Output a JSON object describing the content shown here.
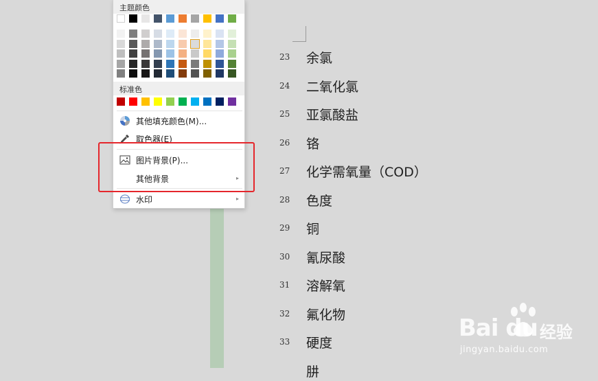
{
  "menu": {
    "theme_header": "主题颜色",
    "standard_header": "标准色",
    "theme_colors": [
      "#ffffff",
      "#000000",
      "#e7e6e6",
      "#44546a",
      "#5b9bd5",
      "#ed7d31",
      "#a5a5a5",
      "#ffc000",
      "#4472c4",
      "#70ad47"
    ],
    "shade_columns": [
      [
        "#f2f2f2",
        "#d9d9d9",
        "#bfbfbf",
        "#a6a6a6",
        "#808080"
      ],
      [
        "#7f7f7f",
        "#595959",
        "#404040",
        "#262626",
        "#0d0d0d"
      ],
      [
        "#d0cece",
        "#aeabab",
        "#757171",
        "#3a3838",
        "#171616"
      ],
      [
        "#d6dce5",
        "#adb9ca",
        "#8497b0",
        "#333f50",
        "#222a35"
      ],
      [
        "#deebf7",
        "#bdd7ee",
        "#9dc3e6",
        "#2e75b6",
        "#1f4e79"
      ],
      [
        "#fbe5d6",
        "#f8cbad",
        "#f4b183",
        "#c55a11",
        "#843c0c"
      ],
      [
        "#ededed",
        "#dbdbdb",
        "#c9c9c9",
        "#7b7b7b",
        "#525252"
      ],
      [
        "#fff2cc",
        "#ffe699",
        "#ffd966",
        "#bf9000",
        "#7f6000"
      ],
      [
        "#dae3f3",
        "#b4c7e7",
        "#8faadc",
        "#2f5597",
        "#203864"
      ],
      [
        "#e2f0d9",
        "#c5e0b4",
        "#a9d18e",
        "#548235",
        "#385723"
      ]
    ],
    "standard_colors": [
      "#c00000",
      "#ff0000",
      "#ffc000",
      "#ffff00",
      "#92d050",
      "#00b050",
      "#00b0f0",
      "#0070c0",
      "#002060",
      "#7030a0"
    ],
    "more_fill_label": "其他填充颜色(M)...",
    "eyedropper_label": "取色器(E)",
    "picture_bg_label": "图片背景(P)...",
    "other_bg_label": "其他背景",
    "watermark_label": "水印"
  },
  "document": {
    "rows": [
      {
        "num": "23",
        "term": "余氯"
      },
      {
        "num": "24",
        "term": "二氧化氯"
      },
      {
        "num": "25",
        "term": "亚氯酸盐"
      },
      {
        "num": "26",
        "term": "铬"
      },
      {
        "num": "27",
        "term": "化学需氧量（COD）"
      },
      {
        "num": "28",
        "term": "色度"
      },
      {
        "num": "29",
        "term": "铜"
      },
      {
        "num": "30",
        "term": "氰尿酸"
      },
      {
        "num": "31",
        "term": "溶解氧"
      },
      {
        "num": "32",
        "term": "氟化物"
      },
      {
        "num": "33",
        "term": "硬度"
      },
      {
        "num": "",
        "term": "肼"
      }
    ]
  },
  "watermark": {
    "logo": "Bai du",
    "brand": "经验",
    "url": "jingyan.baidu.com"
  }
}
